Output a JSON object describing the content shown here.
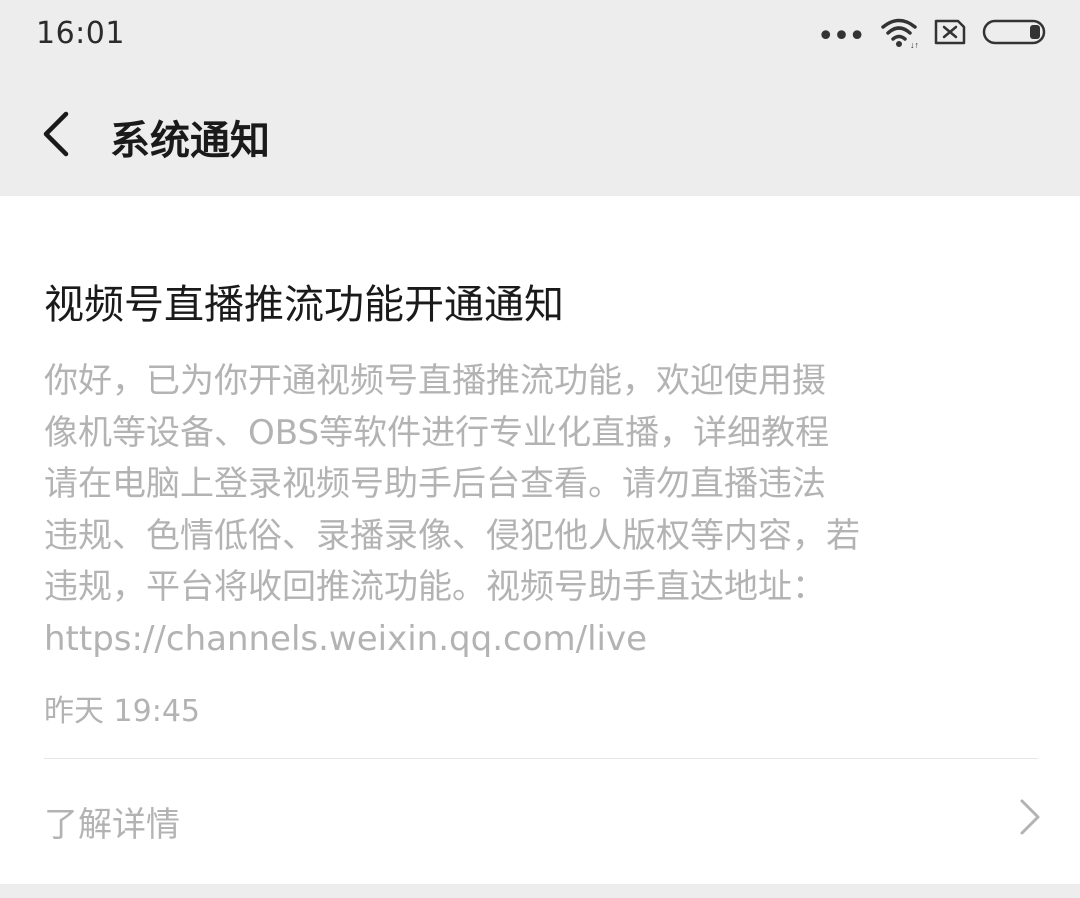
{
  "status_bar": {
    "time": "16:01",
    "icons": [
      "more-dots-icon",
      "wifi-icon",
      "sim-off-icon",
      "battery-icon"
    ]
  },
  "nav": {
    "back_icon": "back-chevron-icon",
    "title": "系统通知"
  },
  "notification": {
    "title": "视频号直播推流功能开通通知",
    "body_lines": [
      "你好，已为你开通视频号直播推流功能，欢迎使用摄",
      "像机等设备、OBS等软件进行专业化直播，详细教程",
      "请在电脑上登录视频号助手后台查看。请勿直播违法",
      "违规、色情低俗、录播录像、侵犯他人版权等内容，若",
      "违规，平台将收回推流功能。视频号助手直达地址：",
      "https://channels.weixin.qq.com/live"
    ],
    "time": "昨天 19:45",
    "detail_label": "了解详情",
    "detail_icon": "chevron-right-icon"
  },
  "colors": {
    "background": "#ededed",
    "card": "#ffffff",
    "title_text": "#1a1a1a",
    "muted_text": "#b3b3b3"
  }
}
